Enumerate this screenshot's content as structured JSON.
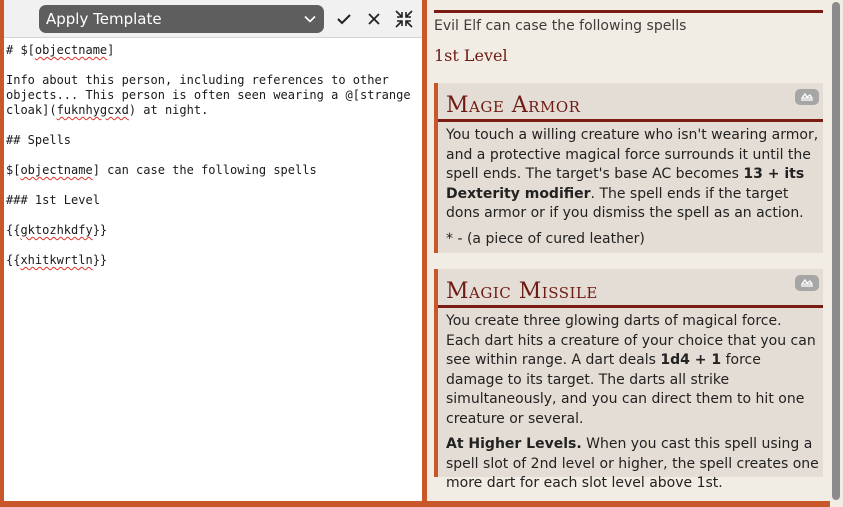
{
  "toolbar": {
    "template_select_value": "Apply Template",
    "icons": [
      "chevron-down-icon",
      "check-icon",
      "close-icon",
      "collapse-icon"
    ]
  },
  "editor": {
    "lines": [
      "# $[objectname]",
      "",
      "Info about this person, including references to other objects... This person is often seen wearing a @[strange cloak](fuknhygcxd) at night.",
      "",
      "## Spells",
      "",
      "$[objectname] can case the following spells",
      "",
      "### 1st Level",
      "",
      "{{gktozhkdfy}}",
      "",
      "{{xhitkwrtln}}"
    ]
  },
  "preview": {
    "intro": "Evil Elf can case the following spells",
    "level_heading": "1st Level",
    "spells": [
      {
        "title": "Mage Armor",
        "description_parts": [
          "You touch a willing creature who isn't wearing armor, and a protective magical force surrounds it until the spell ends. The target's base AC becomes ",
          "13 + its Dexterity modifier",
          ". The spell ends if the target dons armor or if you dismiss the spell as an action."
        ],
        "note": "* - (a piece of cured leather)"
      },
      {
        "title": "Magic Missile",
        "description_parts": [
          "You create three glowing darts of magical force. Each dart hits a creature of your choice that you can see within range. A dart deals ",
          "1d4 + 1",
          " force damage to its target. The darts all strike simultaneously, and you can direct them to hit one creature or several."
        ],
        "higher_label": "At Higher Levels.",
        "higher_text": " When you cast this spell using a spell slot of 2nd level or higher, the spell creates one more dart for each slot level above 1st."
      }
    ]
  },
  "colors": {
    "frame": "#c8582a",
    "heading": "#6e1b13",
    "rule": "#7a1c14",
    "card_bg": "#e4ddd5",
    "preview_bg": "#f1ece4"
  }
}
